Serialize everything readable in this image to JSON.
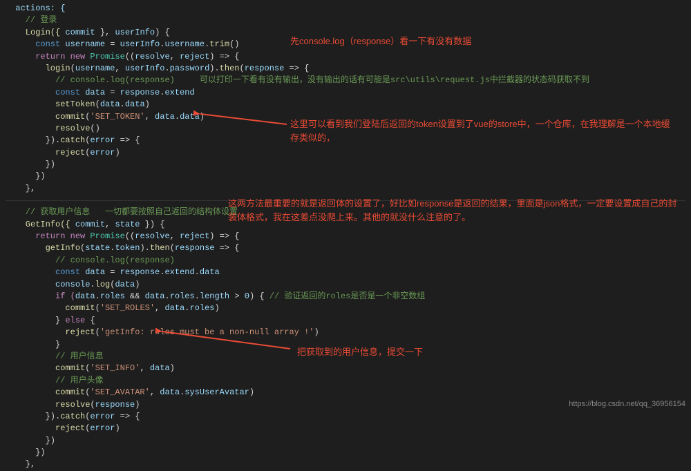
{
  "code": {
    "l1": "  actions: {",
    "l2": "    // 登录",
    "l3a": "    Login({ ",
    "l3b": "commit",
    "l3c": " }, ",
    "l3d": "userInfo",
    "l3e": ") {",
    "l4a": "      const ",
    "l4b": "username",
    "l4c": " = ",
    "l4d": "userInfo",
    "l4e": ".",
    "l4f": "username",
    "l4g": ".",
    "l4h": "trim",
    "l4i": "()",
    "l5a": "      return new ",
    "l5b": "Promise",
    "l5c": "((",
    "l5d": "resolve",
    "l5e": ", ",
    "l5f": "reject",
    "l5g": ") => {",
    "l6a": "        login",
    "l6b": "(",
    "l6c": "username",
    "l6d": ", ",
    "l6e": "userInfo",
    "l6f": ".",
    "l6g": "password",
    "l6h": ").",
    "l6i": "then",
    "l6j": "(",
    "l6k": "response",
    "l6l": " => {",
    "l7": "          // console.log(response)     可以打印一下看有没有输出，没有输出的话有可能是src\\utils\\request.js中拦截器的状态码获取不到",
    "l8a": "          const ",
    "l8b": "data",
    "l8c": " = ",
    "l8d": "response",
    "l8e": ".",
    "l8f": "extend",
    "l9a": "          setToken",
    "l9b": "(",
    "l9c": "data",
    "l9d": ".",
    "l9e": "data",
    "l9f": ")",
    "l10a": "          commit",
    "l10b": "(",
    "l10c": "'SET_TOKEN'",
    "l10d": ", ",
    "l10e": "data",
    "l10f": ".",
    "l10g": "data",
    "l10h": ")",
    "l11a": "          resolve",
    "l11b": "()",
    "l12a": "        }).",
    "l12b": "catch",
    "l12c": "(",
    "l12d": "error",
    "l12e": " => {",
    "l13a": "          reject",
    "l13b": "(",
    "l13c": "error",
    "l13d": ")",
    "l14": "        })",
    "l15": "      })",
    "l16": "    },",
    "l17": "",
    "l18": "    // 获取用户信息   一切都要按照自己返回的结构体设置",
    "l19a": "    GetInfo({ ",
    "l19b": "commit",
    "l19c": ", ",
    "l19d": "state",
    "l19e": " }) {",
    "l20a": "      return new ",
    "l20b": "Promise",
    "l20c": "((",
    "l20d": "resolve",
    "l20e": ", ",
    "l20f": "reject",
    "l20g": ") => {",
    "l21a": "        getInfo",
    "l21b": "(",
    "l21c": "state",
    "l21d": ".",
    "l21e": "token",
    "l21f": ").",
    "l21g": "then",
    "l21h": "(",
    "l21i": "response",
    "l21j": " => {",
    "l22": "          // console.log(response)",
    "l23a": "          const ",
    "l23b": "data",
    "l23c": " = ",
    "l23d": "response",
    "l23e": ".",
    "l23f": "extend",
    "l23g": ".",
    "l23h": "data",
    "l24a": "          console",
    "l24b": ".",
    "l24c": "log",
    "l24d": "(",
    "l24e": "data",
    "l24f": ")",
    "l25a": "          if (",
    "l25b": "data",
    "l25c": ".",
    "l25d": "roles",
    "l25e": " && ",
    "l25f": "data",
    "l25g": ".",
    "l25h": "roles",
    "l25i": ".",
    "l25j": "length",
    "l25k": " > ",
    "l25l": "0",
    "l25m": ") { ",
    "l25n": "// 验证返回的roles是否是一个非空数组",
    "l26a": "            commit",
    "l26b": "(",
    "l26c": "'SET_ROLES'",
    "l26d": ", ",
    "l26e": "data",
    "l26f": ".",
    "l26g": "roles",
    "l26h": ")",
    "l27a": "          } ",
    "l27b": "else",
    "l27c": " {",
    "l28a": "            reject",
    "l28b": "(",
    "l28c": "'getInfo: roles must be a non-null array !'",
    "l28d": ")",
    "l29": "          }",
    "l30": "          // 用户信息",
    "l31a": "          commit",
    "l31b": "(",
    "l31c": "'SET_INFO'",
    "l31d": ", ",
    "l31e": "data",
    "l31f": ")",
    "l32": "          // 用户头像",
    "l33a": "          commit",
    "l33b": "(",
    "l33c": "'SET_AVATAR'",
    "l33d": ", ",
    "l33e": "data",
    "l33f": ".",
    "l33g": "sysUserAvatar",
    "l33h": ")",
    "l34a": "          resolve",
    "l34b": "(",
    "l34c": "response",
    "l34d": ")",
    "l35a": "        }).",
    "l35b": "catch",
    "l35c": "(",
    "l35d": "error",
    "l35e": " => {",
    "l36a": "          reject",
    "l36b": "(",
    "l36c": "error",
    "l36d": ")",
    "l37": "        })",
    "l38": "      })",
    "l39": "    },"
  },
  "annotations": {
    "a1": "先console.log（response）看一下有没有数据",
    "a2": "这里可以看到我们登陆后返回的token设置到了vue的store中，一个仓库，在我理解是一个本地缓存类似的，",
    "a3": "这两方法最重要的就是返回体的设置了，好比如response是返回的结果，里面是json格式，一定要设置成自己的封装体格式，我在这差点没爬上来。其他的就没什么注意的了。",
    "a4": "把获取到的用户信息，提交一下"
  },
  "watermark": "https://blog.csdn.net/qq_36956154"
}
